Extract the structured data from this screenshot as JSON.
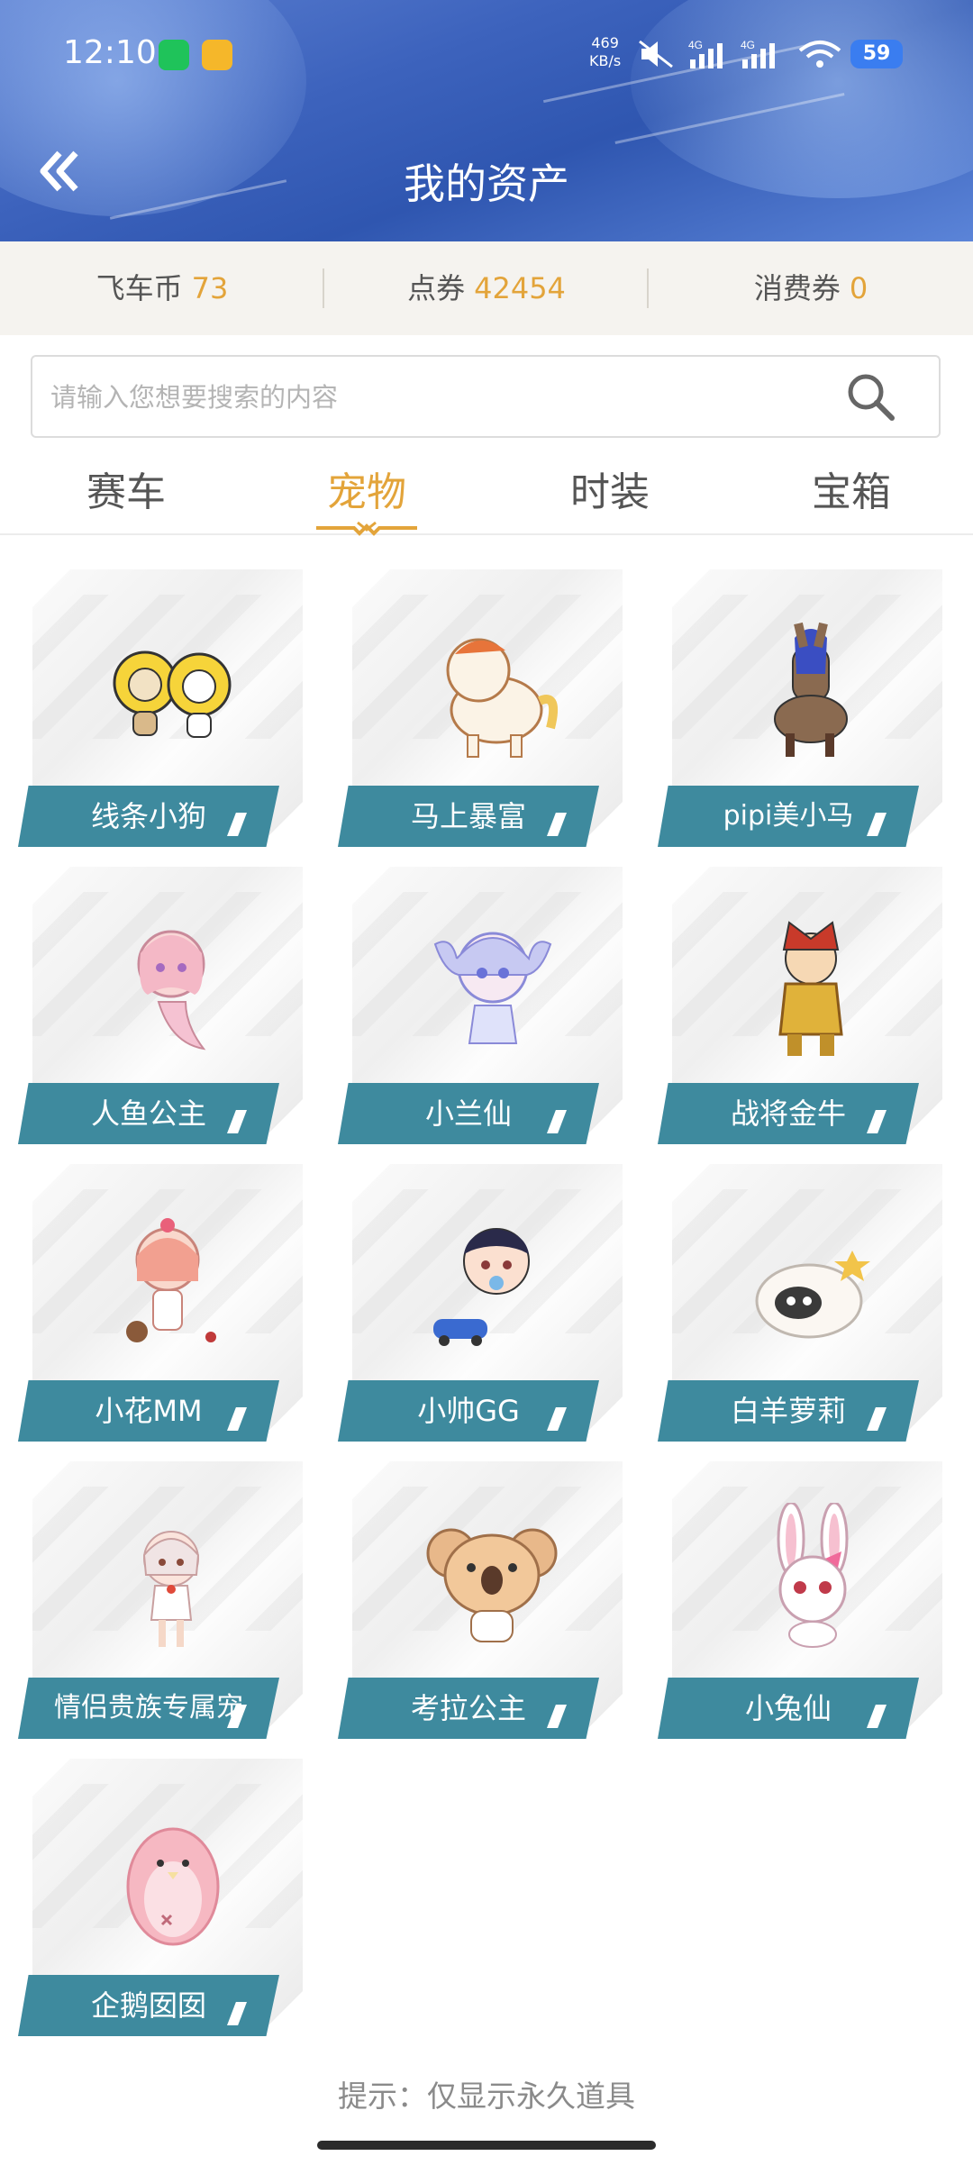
{
  "status_bar": {
    "time": "12:10",
    "net_speed_value": "469",
    "net_speed_unit": "KB/s",
    "signal_1": "4G",
    "signal_2": "4G",
    "battery": "59"
  },
  "header": {
    "title": "我的资产"
  },
  "balances": [
    {
      "label": "飞车币",
      "value": "73"
    },
    {
      "label": "点券",
      "value": "42454"
    },
    {
      "label": "消费券",
      "value": "0"
    }
  ],
  "search": {
    "placeholder": "请输入您想要搜索的内容",
    "value": ""
  },
  "tabs": [
    {
      "label": "赛车",
      "active": false
    },
    {
      "label": "宠物",
      "active": true
    },
    {
      "label": "时装",
      "active": false
    },
    {
      "label": "宝箱",
      "active": false
    }
  ],
  "pets": [
    {
      "name": "线条小狗",
      "icon": "yellow-flower-dogs-icon"
    },
    {
      "name": "马上暴富",
      "icon": "cream-horse-icon"
    },
    {
      "name": "pipi美小马",
      "icon": "blue-mane-pony-icon"
    },
    {
      "name": "人鱼公主",
      "icon": "mermaid-princess-icon"
    },
    {
      "name": "小兰仙",
      "icon": "blue-fairy-girl-icon"
    },
    {
      "name": "战将金牛",
      "icon": "golden-warrior-icon"
    },
    {
      "name": "小花MM",
      "icon": "flower-girl-icon"
    },
    {
      "name": "小帅GG",
      "icon": "baby-boy-icon"
    },
    {
      "name": "白羊萝莉",
      "icon": "white-sheep-icon"
    },
    {
      "name": "情侣贵族专属宠",
      "icon": "noble-girl-icon"
    },
    {
      "name": "考拉公主",
      "icon": "koala-icon"
    },
    {
      "name": "小兔仙",
      "icon": "rabbit-icon"
    },
    {
      "name": "企鹅囡囡",
      "icon": "pink-penguin-icon"
    }
  ],
  "colors": {
    "accent": "#e3a43a",
    "label_bg": "#3e8a9e",
    "header_blue": "#3d63bd"
  },
  "footer": {
    "hint": "提示：仅显示永久道具"
  }
}
